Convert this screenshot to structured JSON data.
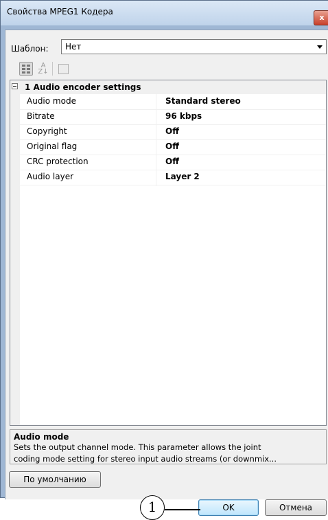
{
  "window": {
    "title": "Свойства MPEG1 Кодера",
    "close_glyph": "x"
  },
  "template": {
    "label": "Шаблон:",
    "value": "Нет"
  },
  "toolbar": {
    "buttons": [
      "categorized-icon",
      "sort-alphabetical-icon",
      "property-pages-icon"
    ],
    "sort_glyph": "A\nZ↓"
  },
  "grid": {
    "category": {
      "expander": "⊟",
      "label": "1 Audio encoder settings"
    },
    "properties": [
      {
        "name": "Audio mode",
        "value": "Standard stereo"
      },
      {
        "name": "Bitrate",
        "value": "96 kbps"
      },
      {
        "name": "Copyright",
        "value": "Off"
      },
      {
        "name": "Original flag",
        "value": "Off"
      },
      {
        "name": "CRC protection",
        "value": "Off"
      },
      {
        "name": "Audio layer",
        "value": "Layer 2"
      }
    ]
  },
  "description": {
    "title": "Audio mode",
    "line1": "Sets the output channel mode. This parameter allows the joint",
    "line2": "coding mode setting for stereo input audio streams (or downmix..."
  },
  "buttons": {
    "default": "По умолчанию",
    "ok": "OK",
    "cancel": "Отмена"
  },
  "callout": {
    "number": "1"
  },
  "colors": {
    "title_bar": "#c4d6ec",
    "ok_focus": "#3c7fb1",
    "close": "#c8402a"
  }
}
